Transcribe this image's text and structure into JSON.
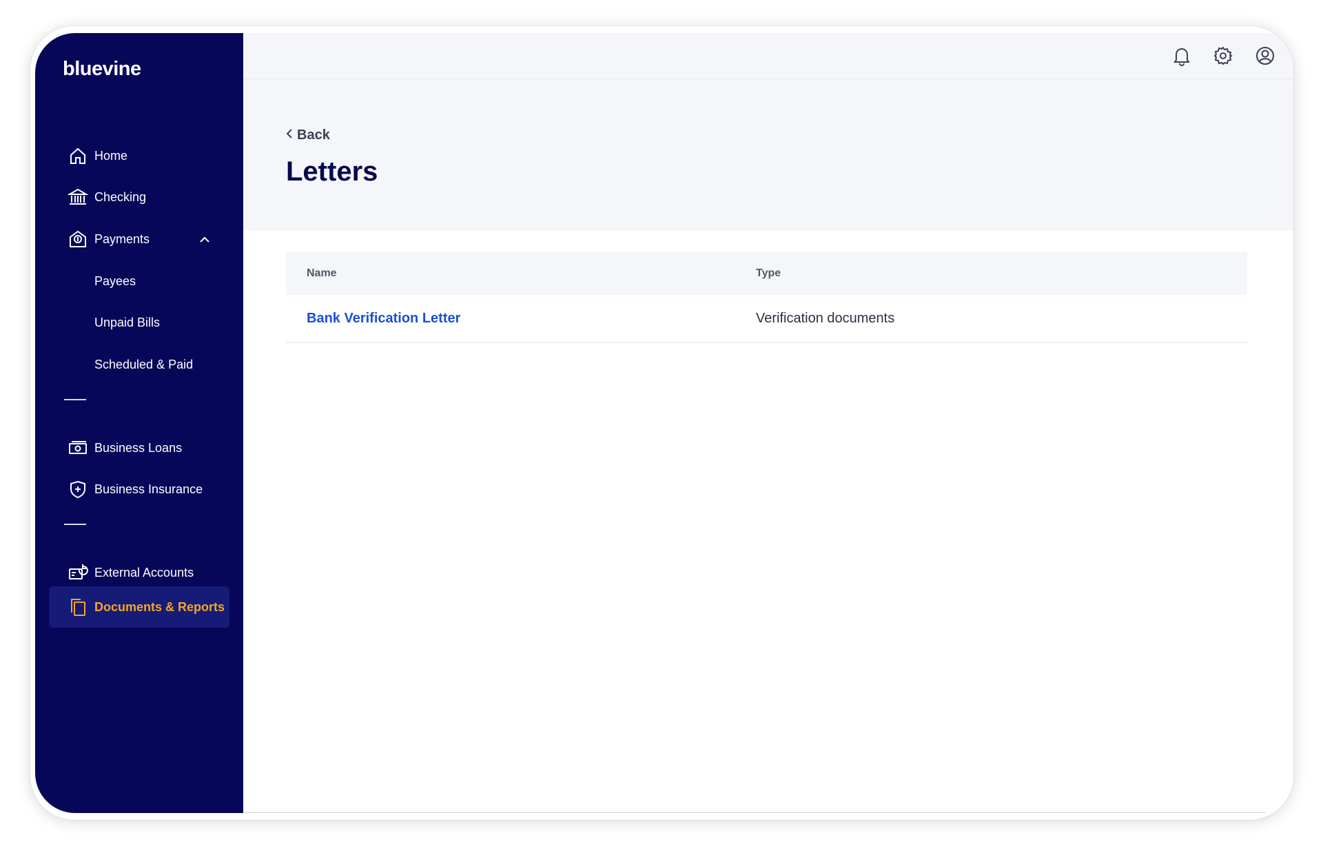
{
  "brand": {
    "logo": "bluevine",
    "nav_color": "#07075a",
    "accent": "#f5a524",
    "link_color": "#1a4fd6"
  },
  "sidebar": {
    "items": [
      {
        "id": "home",
        "label": "Home",
        "icon": "home-icon"
      },
      {
        "id": "checking",
        "label": "Checking",
        "icon": "bank-icon"
      },
      {
        "id": "payments",
        "label": "Payments",
        "icon": "payments-icon",
        "expanded": true
      },
      {
        "id": "payees",
        "label": "Payees"
      },
      {
        "id": "unpaid-bills",
        "label": "Unpaid Bills"
      },
      {
        "id": "scheduled-paid",
        "label": "Scheduled & Paid"
      },
      {
        "id": "business-loans",
        "label": "Business Loans",
        "icon": "money-icon"
      },
      {
        "id": "business-insurance",
        "label": "Business Insurance",
        "icon": "shield-icon"
      },
      {
        "id": "external-accounts",
        "label": "External Accounts",
        "icon": "external-accounts-icon"
      },
      {
        "id": "documents-reports",
        "label": "Documents & Reports",
        "icon": "documents-icon",
        "active": true
      }
    ]
  },
  "topbar": {
    "icons": [
      "bell-icon",
      "gear-icon",
      "user-circle-icon"
    ]
  },
  "page": {
    "back_label": "Back",
    "title": "Letters"
  },
  "table": {
    "columns": [
      "Name",
      "Type"
    ],
    "rows": [
      {
        "name": "Bank Verification Letter",
        "type": "Verification documents"
      }
    ]
  }
}
